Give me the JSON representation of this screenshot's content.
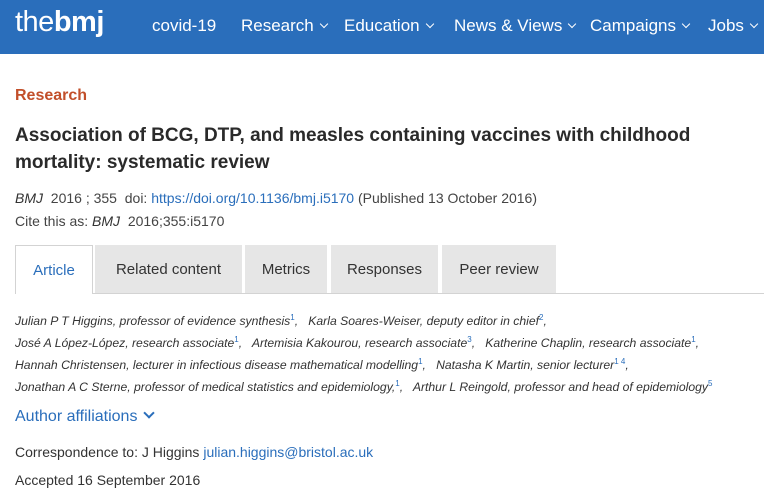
{
  "header": {
    "logo_the": "the",
    "logo_bmj": "bmj",
    "nav": [
      "covid-19",
      "Research",
      "Education",
      "News & Views",
      "Campaigns",
      "Jobs"
    ]
  },
  "article": {
    "section": "Research",
    "title": "Association of BCG, DTP, and measles containing vaccines with childhood mortality: systematic review",
    "journal": "BMJ",
    "year": "2016",
    "volume": " ; 355",
    "doi_label": "doi:",
    "doi": "https://doi.org/10.1136/bmj.i5170",
    "published": "(Published 13 October 2016)",
    "cite_label": "Cite this as:",
    "cite_journal": "BMJ",
    "cite_ref": "2016;355:i5170"
  },
  "tabs": [
    "Article",
    "Related content",
    "Metrics",
    "Responses",
    "Peer review"
  ],
  "authors": [
    {
      "name": "Julian P T Higgins, professor of evidence synthesis",
      "sup": "1"
    },
    {
      "name": "Karla Soares-Weiser, deputy editor in chief",
      "sup": "2"
    },
    {
      "name": "José A López-López, research associate",
      "sup": "1"
    },
    {
      "name": "Artemisia Kakourou, research associate",
      "sup": "3"
    },
    {
      "name": "Katherine Chaplin, research associate",
      "sup": "1"
    },
    {
      "name": "Hannah Christensen, lecturer in infectious disease mathematical modelling",
      "sup": "1"
    },
    {
      "name": "Natasha K Martin, senior lecturer",
      "sup": "1  4"
    },
    {
      "name": "Jonathan A C Sterne, professor of medical statistics and epidemiology,",
      "sup": "1"
    },
    {
      "name": "Arthur L Reingold, professor and head of epidemiology",
      "sup": "5"
    }
  ],
  "affiliations_label": "Author affiliations",
  "correspondence": {
    "label": "Correspondence to: J Higgins",
    "email": "julian.higgins@bristol.ac.uk"
  },
  "accepted": "Accepted 16 September 2016"
}
